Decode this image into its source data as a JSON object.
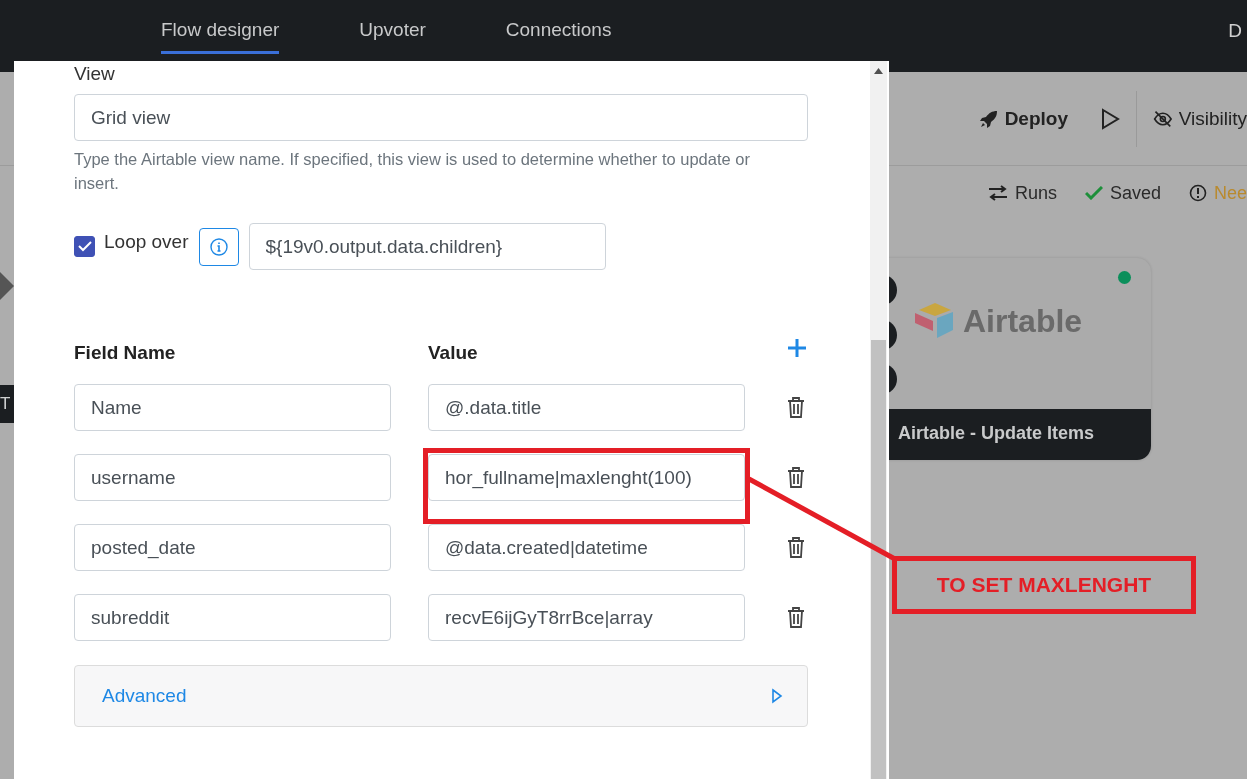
{
  "nav": {
    "tabs": [
      {
        "label": "Flow designer",
        "selected": true
      },
      {
        "label": "Upvoter",
        "selected": false
      },
      {
        "label": "Connections",
        "selected": false
      }
    ],
    "right_text": "D"
  },
  "header": {
    "actions": [
      {
        "kind": "deploy",
        "label": "Deploy"
      },
      {
        "kind": "run"
      },
      {
        "kind": "visibility",
        "label": "Visibility"
      }
    ]
  },
  "status": [
    {
      "kind": "runs",
      "label": "Runs"
    },
    {
      "kind": "saved",
      "label": "Saved"
    },
    {
      "kind": "warning",
      "label": "Nee"
    }
  ],
  "left_node": {
    "label": "T"
  },
  "node": {
    "logo_text": "Airtable",
    "title": "Airtable - Update Items",
    "active": true
  },
  "dialog": {
    "view": {
      "label": "View",
      "value": "Grid view",
      "help": "Type the Airtable view name. If specified, this view is used to determine whether to update or insert."
    },
    "loop": {
      "label": "Loop over",
      "checked": true,
      "value": "${19v0.output.data.children}"
    },
    "columns": [
      "Field Name",
      "Value"
    ],
    "fields": [
      {
        "name": "Name",
        "value": "@.data.title",
        "highlighted": false
      },
      {
        "name": "username",
        "value": "hor_fullname|maxlenght(100)",
        "highlighted": true
      },
      {
        "name": "posted_date",
        "value": "@data.created|datetime",
        "highlighted": false
      },
      {
        "name": "subreddit",
        "value": "recvE6ijGyT8rrBce|array",
        "highlighted": false
      }
    ],
    "advanced": {
      "label": "Advanced",
      "expanded": false
    }
  },
  "annotation": {
    "text": "TO SET MAXLENGHT"
  }
}
